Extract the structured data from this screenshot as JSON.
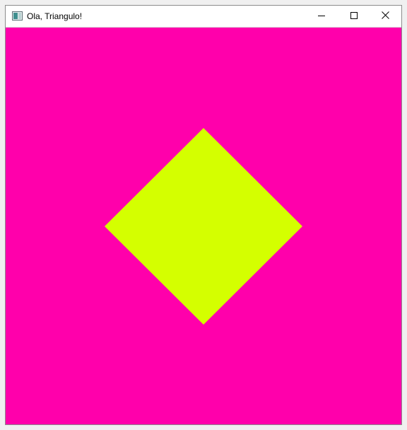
{
  "window": {
    "title": "Ola, Triangulo!"
  },
  "titlebar": {
    "app_icon": "opengl-window-icon",
    "controls": [
      {
        "name": "minimize",
        "icon": "minimize-icon"
      },
      {
        "name": "maximize",
        "icon": "maximize-icon"
      },
      {
        "name": "close",
        "icon": "close-icon"
      }
    ]
  },
  "scene": {
    "background_color": "#ff00ab",
    "shape": "diamond",
    "shape_color": "#d4ff00"
  }
}
